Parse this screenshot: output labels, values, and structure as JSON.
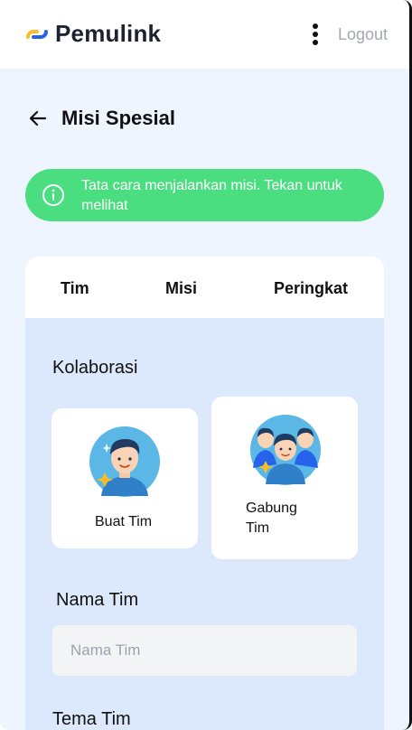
{
  "app": {
    "name": "Pemulink",
    "logout_label": "Logout"
  },
  "page": {
    "title": "Misi Spesial"
  },
  "banner": {
    "text": "Tata cara menjalankan misi. Tekan untuk melihat"
  },
  "tabs": [
    {
      "label": "Tim"
    },
    {
      "label": "Misi"
    },
    {
      "label": "Peringkat"
    }
  ],
  "collab": {
    "title": "Kolaborasi",
    "options": [
      {
        "label": "Buat Tim",
        "icon": "single-person-sparkle-icon"
      },
      {
        "label": "Gabung Tim",
        "icon": "group-people-icon"
      }
    ]
  },
  "form": {
    "team_name_label": "Nama Tim",
    "team_name_placeholder": "Nama Tim",
    "team_theme_label": "Tema Tim"
  },
  "colors": {
    "banner": "#4ade80",
    "page_bg": "#eff5ff",
    "card_bg": "#dce8fb",
    "logo_blue": "#2563eb",
    "logo_yellow": "#fbbf24"
  }
}
